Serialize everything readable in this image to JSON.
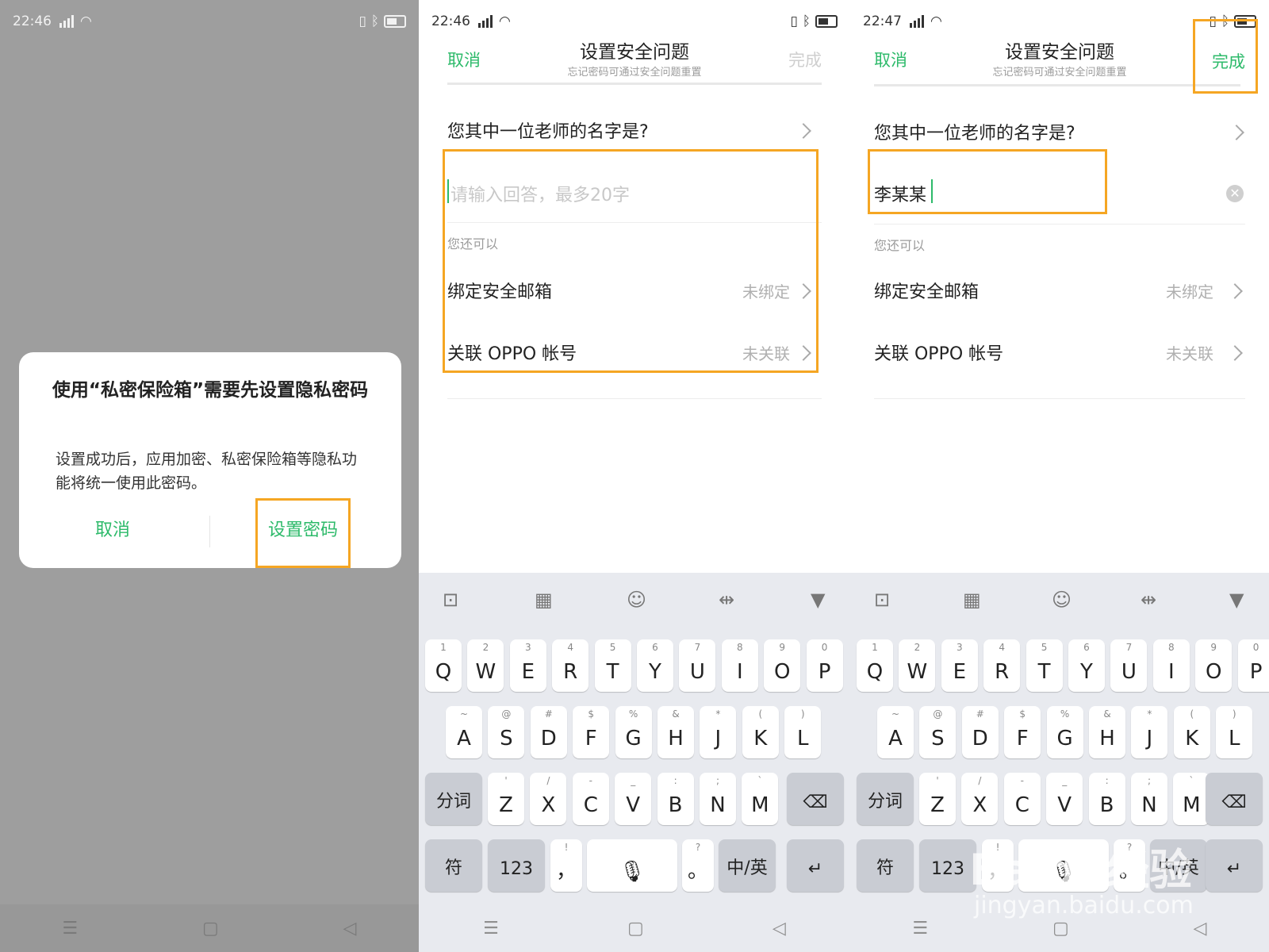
{
  "status": [
    {
      "time": "22:46"
    },
    {
      "time": "22:46"
    },
    {
      "time": "22:47"
    }
  ],
  "dialog": {
    "title": "使用“私密保险箱”需要先设置隐私密码",
    "body": "设置成功后，应用加密、私密保险箱等隐私功能将统一使用此密码。",
    "cancel": "取消",
    "confirm": "设置密码"
  },
  "screen": {
    "cancel": "取消",
    "title": "设置安全问题",
    "subtitle": "忘记密码可通过安全问题重置",
    "done": "完成",
    "question": "您其中一位老师的名字是?",
    "answer_placeholder": "请输入回答，最多20字",
    "answer_value": "李某某",
    "also_label": "您还可以",
    "rows": [
      {
        "label": "绑定安全邮箱",
        "status": "未绑定"
      },
      {
        "label": "关联 OPPO 帐号",
        "status": "未关联"
      }
    ],
    "done_disabled_color": "#cfcfcf",
    "done_enabled_color": "#2dba6a"
  },
  "keyboard": {
    "row1": [
      {
        "k": "Q",
        "h": "1"
      },
      {
        "k": "W",
        "h": "2"
      },
      {
        "k": "E",
        "h": "3"
      },
      {
        "k": "R",
        "h": "4"
      },
      {
        "k": "T",
        "h": "5"
      },
      {
        "k": "Y",
        "h": "6"
      },
      {
        "k": "U",
        "h": "7"
      },
      {
        "k": "I",
        "h": "8"
      },
      {
        "k": "O",
        "h": "9"
      },
      {
        "k": "P",
        "h": "0"
      }
    ],
    "row2": [
      {
        "k": "A",
        "h": "~"
      },
      {
        "k": "S",
        "h": "@"
      },
      {
        "k": "D",
        "h": "#"
      },
      {
        "k": "F",
        "h": "$"
      },
      {
        "k": "G",
        "h": "%"
      },
      {
        "k": "H",
        "h": "&"
      },
      {
        "k": "J",
        "h": "*"
      },
      {
        "k": "K",
        "h": "("
      },
      {
        "k": "L",
        "h": ")"
      }
    ],
    "row3": [
      {
        "k": "Z",
        "h": "'"
      },
      {
        "k": "X",
        "h": "/"
      },
      {
        "k": "C",
        "h": "-"
      },
      {
        "k": "V",
        "h": "_"
      },
      {
        "k": "B",
        "h": ":"
      },
      {
        "k": "N",
        "h": ";"
      },
      {
        "k": "M",
        "h": "`"
      }
    ],
    "segment": "分词",
    "symbols": "符",
    "numbers": "123",
    "comma": "，",
    "period": "。",
    "period_hint": "?",
    "comma_hint": "!",
    "lang": "中/英"
  },
  "watermark": {
    "logo": "Baidu经验",
    "url": "jingyan.baidu.com"
  },
  "accent_color": "#2dba6a",
  "highlight_color": "#f5a623"
}
